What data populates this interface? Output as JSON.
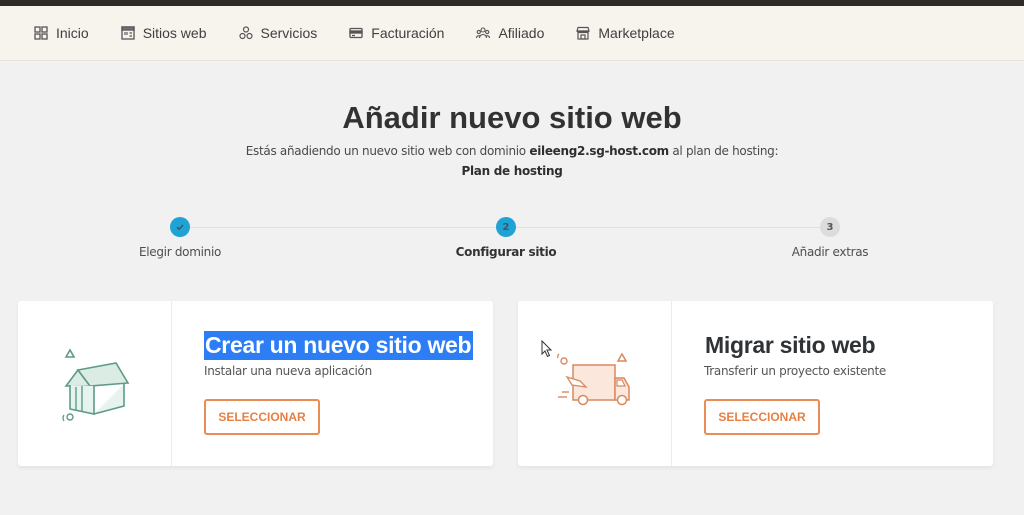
{
  "nav": {
    "items": [
      {
        "label": "Inicio",
        "icon": "dashboard-grid-icon"
      },
      {
        "label": "Sitios web",
        "icon": "website-icon"
      },
      {
        "label": "Servicios",
        "icon": "services-icon"
      },
      {
        "label": "Facturación",
        "icon": "credit-card-icon"
      },
      {
        "label": "Afiliado",
        "icon": "affiliate-people-icon"
      },
      {
        "label": "Marketplace",
        "icon": "store-icon"
      }
    ]
  },
  "header": {
    "title": "Añadir nuevo sitio web",
    "subtitle_prefix": "Estás añadiendo un nuevo sitio web con dominio",
    "domain": "eileeng2.sg-host.com",
    "subtitle_suffix": "al plan de hosting:",
    "plan": "Plan de hosting"
  },
  "stepper": {
    "steps": [
      {
        "number": "✓",
        "label": "Elegir dominio",
        "state": "done"
      },
      {
        "number": "2",
        "label": "Configurar sitio",
        "state": "active"
      },
      {
        "number": "3",
        "label": "Añadir extras",
        "state": "pending"
      }
    ]
  },
  "cards": [
    {
      "title": "Crear un nuevo sitio web",
      "description": "Instalar una nueva aplicación",
      "button": "SELECCIONAR",
      "icon": "house-illustration-icon"
    },
    {
      "title": "Migrar sitio web",
      "description": "Transferir un proyecto existente",
      "button": "SELECCIONAR",
      "icon": "delivery-truck-illustration-icon"
    }
  ],
  "colors": {
    "accent_blue": "#1fa3d4",
    "button_orange": "#e98c55",
    "selection_blue": "#2d7ef5",
    "house_green": "#5e9a86",
    "truck_orange": "#d9895f"
  }
}
